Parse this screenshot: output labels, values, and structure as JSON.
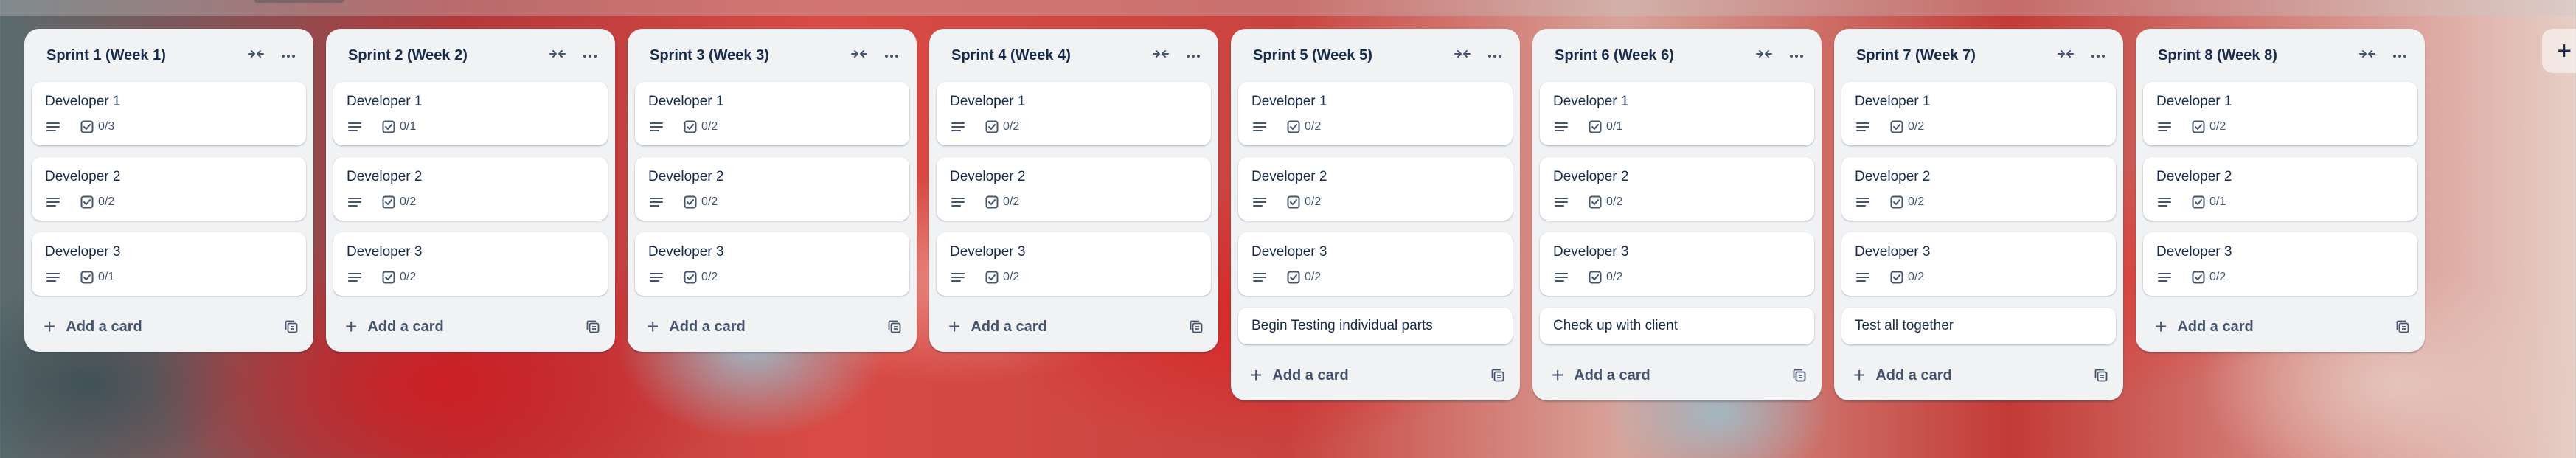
{
  "lists": [
    {
      "title": "Sprint 1 (Week 1)",
      "cards": [
        {
          "title": "Developer 1",
          "checklist": "0/3"
        },
        {
          "title": "Developer 2",
          "checklist": "0/2"
        },
        {
          "title": "Developer 3",
          "checklist": "0/1"
        }
      ],
      "extra_card": null
    },
    {
      "title": "Sprint 2 (Week 2)",
      "cards": [
        {
          "title": "Developer 1",
          "checklist": "0/1"
        },
        {
          "title": "Developer 2",
          "checklist": "0/2"
        },
        {
          "title": "Developer 3",
          "checklist": "0/2"
        }
      ],
      "extra_card": null
    },
    {
      "title": "Sprint 3 (Week 3)",
      "cards": [
        {
          "title": "Developer 1",
          "checklist": "0/2"
        },
        {
          "title": "Developer 2",
          "checklist": "0/2"
        },
        {
          "title": "Developer 3",
          "checklist": "0/2"
        }
      ],
      "extra_card": null
    },
    {
      "title": "Sprint 4 (Week 4)",
      "cards": [
        {
          "title": "Developer 1",
          "checklist": "0/2"
        },
        {
          "title": "Developer 2",
          "checklist": "0/2"
        },
        {
          "title": "Developer 3",
          "checklist": "0/2"
        }
      ],
      "extra_card": null
    },
    {
      "title": "Sprint 5 (Week 5)",
      "cards": [
        {
          "title": "Developer 1",
          "checklist": "0/2"
        },
        {
          "title": "Developer 2",
          "checklist": "0/2"
        },
        {
          "title": "Developer 3",
          "checklist": "0/2"
        }
      ],
      "extra_card": "Begin Testing individual parts"
    },
    {
      "title": "Sprint 6 (Week 6)",
      "cards": [
        {
          "title": "Developer 1",
          "checklist": "0/1"
        },
        {
          "title": "Developer 2",
          "checklist": "0/2"
        },
        {
          "title": "Developer 3",
          "checklist": "0/2"
        }
      ],
      "extra_card": "Check up with client"
    },
    {
      "title": "Sprint 7 (Week 7)",
      "cards": [
        {
          "title": "Developer 1",
          "checklist": "0/2"
        },
        {
          "title": "Developer 2",
          "checklist": "0/2"
        },
        {
          "title": "Developer 3",
          "checklist": "0/2"
        }
      ],
      "extra_card": "Test all together"
    },
    {
      "title": "Sprint 8 (Week 8)",
      "cards": [
        {
          "title": "Developer 1",
          "checklist": "0/2"
        },
        {
          "title": "Developer 2",
          "checklist": "0/1"
        },
        {
          "title": "Developer 3",
          "checklist": "0/2"
        }
      ],
      "extra_card": null
    }
  ],
  "add_card_label": "Add a card",
  "add_list_symbol": "+",
  "icons": {
    "collapse": "collapse-arrows-icon",
    "more": "more-dots-icon",
    "description": "description-lines-icon",
    "checklist": "checkbox-icon",
    "template": "card-template-icon",
    "add": "plus-icon"
  }
}
